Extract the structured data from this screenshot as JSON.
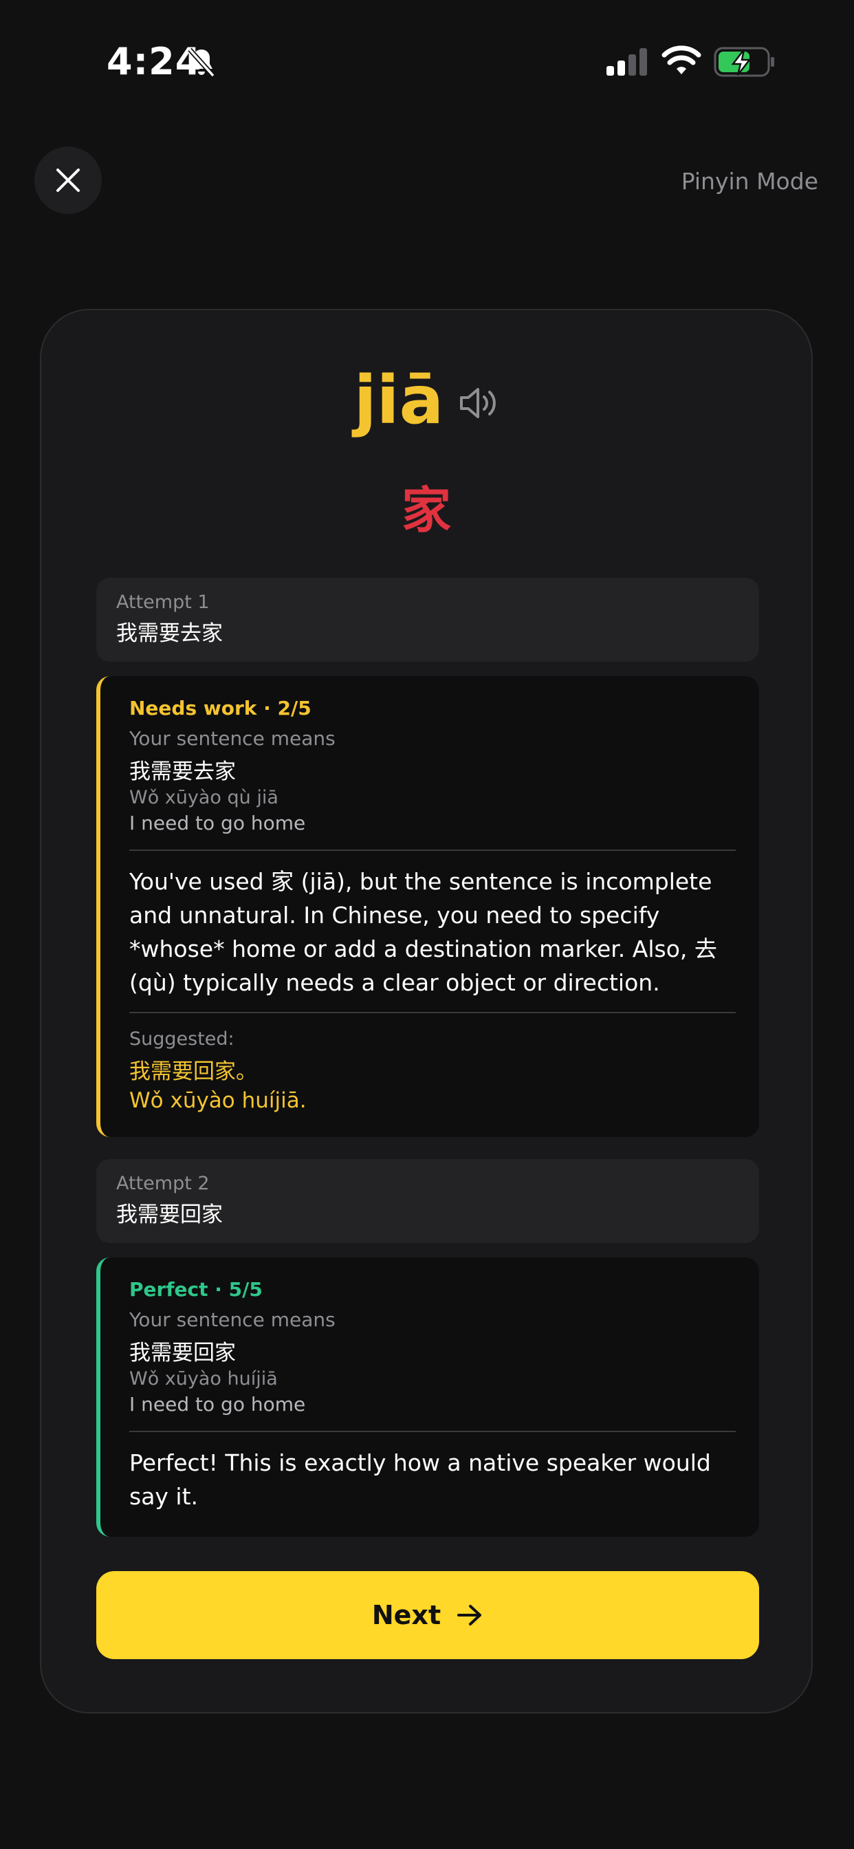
{
  "status_bar": {
    "time": "4:24"
  },
  "header": {
    "close_icon": "close-icon",
    "mode_label": "Pinyin Mode"
  },
  "card": {
    "pinyin": "jiā",
    "hanzi": "家",
    "speaker_icon": "speaker-icon"
  },
  "attempts": [
    {
      "label": "Attempt 1",
      "text": "我需要去家",
      "feedback": {
        "status": "Needs work · 2/5",
        "means_label": "Your sentence means",
        "hanzi": "我需要去家",
        "pinyin": "Wǒ xūyào qù jiā",
        "english": "I need to go home",
        "explanation": "You've used 家 (jiā), but the sentence is incomplete and unnatural. In Chinese, you need to specify *whose* home or add a destination marker. Also, 去 (qù) typically needs a clear object or direction.",
        "suggested_label": "Suggested:",
        "suggested_hanzi": "我需要回家。",
        "suggested_pinyin": "Wǒ xūyào huíjiā."
      }
    },
    {
      "label": "Attempt 2",
      "text": "我需要回家",
      "feedback": {
        "status": "Perfect · 5/5",
        "means_label": "Your sentence means",
        "hanzi": "我需要回家",
        "pinyin": "Wǒ xūyào huíjiā",
        "english": "I need to go home",
        "explanation": "Perfect! This is exactly how a native speaker would say it."
      }
    }
  ],
  "next_button": {
    "label": "Next",
    "icon": "arrow-right-icon"
  },
  "colors": {
    "accent_yellow": "#f4c430",
    "button_yellow": "#ffd829",
    "hanzi_red": "#e0323f",
    "success_green": "#2ec78a",
    "battery_green": "#34c759"
  }
}
